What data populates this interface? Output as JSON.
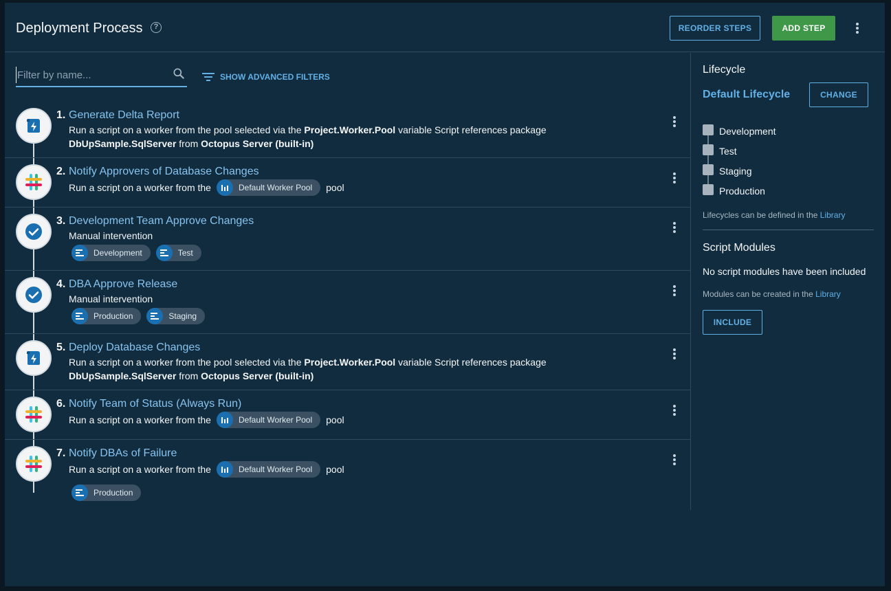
{
  "header": {
    "title": "Deployment Process",
    "help_glyph": "?",
    "reorder_label": "REORDER STEPS",
    "add_step_label": "ADD STEP"
  },
  "filter": {
    "placeholder": "Filter by name...",
    "advanced_label": "SHOW ADVANCED FILTERS"
  },
  "steps": [
    {
      "number": "1.",
      "name": "Generate Delta Report",
      "icon": "script-icon",
      "desc": {
        "t1": "Run a script on a worker from the pool selected via the ",
        "b1": "Project.Worker.Pool",
        "t2": " variable Script references package ",
        "b2": "DbUpSample.SqlServer",
        "t3": " from ",
        "b3": "Octopus Server (built-in)"
      }
    },
    {
      "number": "2.",
      "name": "Notify Approvers of Database Changes",
      "icon": "slack-icon",
      "desc_prefix": "Run a script on a worker from the",
      "pool": "Default Worker Pool",
      "desc_suffix": "pool"
    },
    {
      "number": "3.",
      "name": "Development Team Approve Changes",
      "icon": "check-icon",
      "desc": "Manual intervention",
      "envs": [
        "Development",
        "Test"
      ]
    },
    {
      "number": "4.",
      "name": "DBA Approve Release",
      "icon": "check-icon",
      "desc": "Manual intervention",
      "envs": [
        "Production",
        "Staging"
      ]
    },
    {
      "number": "5.",
      "name": "Deploy Database Changes",
      "icon": "script-icon",
      "desc": {
        "t1": "Run a script on a worker from the pool selected via the ",
        "b1": "Project.Worker.Pool",
        "t2": " variable Script references package ",
        "b2": "DbUpSample.SqlServer",
        "t3": " from ",
        "b3": "Octopus Server (built-in)"
      }
    },
    {
      "number": "6.",
      "name": "Notify Team of Status (Always Run)",
      "icon": "slack-icon",
      "desc_prefix": "Run a script on a worker from the",
      "pool": "Default Worker Pool",
      "desc_suffix": "pool"
    },
    {
      "number": "7.",
      "name": "Notify DBAs of Failure",
      "icon": "slack-icon",
      "desc_prefix": "Run a script on a worker from the",
      "pool": "Default Worker Pool",
      "desc_suffix": "pool",
      "envs": [
        "Production"
      ]
    }
  ],
  "sidebar": {
    "lifecycle_heading": "Lifecycle",
    "lifecycle_name": "Default Lifecycle",
    "change_label": "CHANGE",
    "phases": [
      "Development",
      "Test",
      "Staging",
      "Production"
    ],
    "lifecycle_note": "Lifecycles can be defined in the ",
    "lifecycle_note_link": "Library",
    "modules_heading": "Script Modules",
    "no_modules": "No script modules have been included",
    "modules_note": "Modules can be created in the ",
    "modules_note_link": "Library",
    "include_label": "INCLUDE"
  },
  "colors": {
    "accent": "#62b0e6",
    "link": "#87c3ef",
    "add_step": "#3f9848",
    "background": "#112c3e"
  }
}
